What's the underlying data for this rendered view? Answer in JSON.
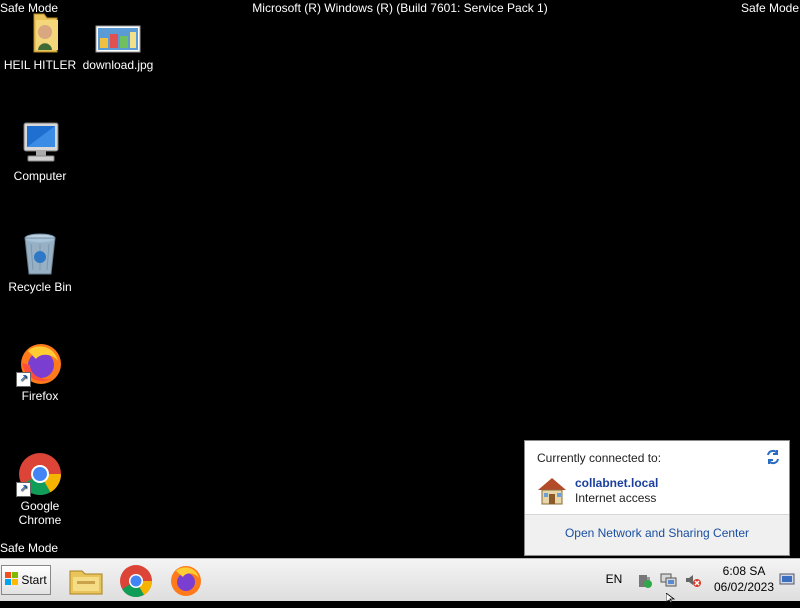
{
  "screen": {
    "safe_mode_label": "Safe Mode",
    "os_title": "Microsoft (R) Windows (R) (Build 7601: Service Pack 1)"
  },
  "desktop_icons": [
    {
      "label": "HEIL HITLER",
      "icon": "folder-icon"
    },
    {
      "label": "download.jpg",
      "icon": "image-file-icon"
    },
    {
      "label": "Computer",
      "icon": "computer-icon"
    },
    {
      "label": "Recycle Bin",
      "icon": "recycle-bin-icon"
    },
    {
      "label": "Firefox",
      "icon": "firefox-icon"
    },
    {
      "label": "Google Chrome",
      "icon": "chrome-icon"
    }
  ],
  "taskbar": {
    "start_label": "Start",
    "pinned": [
      "file-explorer-icon",
      "chrome-icon",
      "firefox-icon"
    ],
    "language": "EN",
    "clock_time": "6:08 SA",
    "clock_date": "06/02/2023"
  },
  "network_popup": {
    "header": "Currently connected to:",
    "network_name": "collabnet.local",
    "network_status": "Internet access",
    "footer_link": "Open Network and Sharing Center"
  },
  "colors": {
    "desktop_bg": "#000000",
    "link": "#1a4fa0",
    "network_name": "#1a3f9c"
  }
}
